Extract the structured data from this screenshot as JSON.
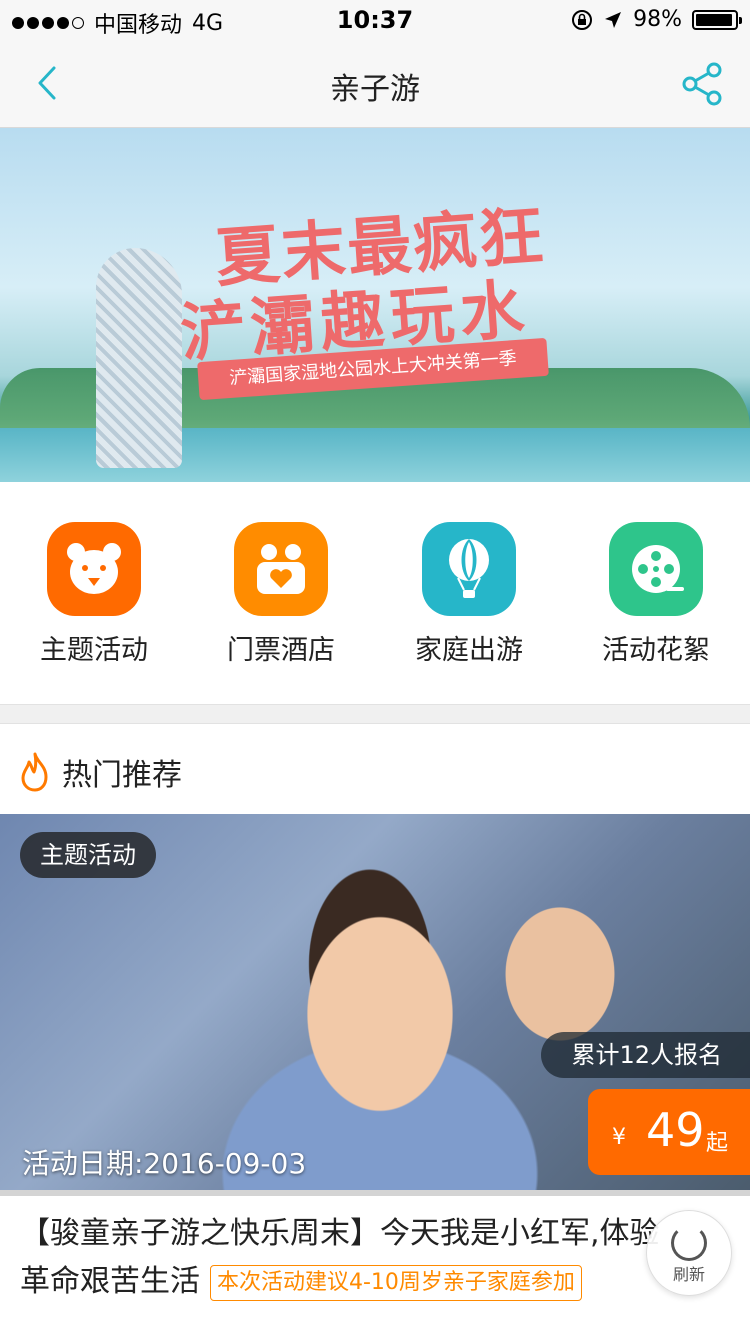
{
  "status_bar": {
    "carrier": "中国移动",
    "network": "4G",
    "time": "10:37",
    "battery": "98%"
  },
  "nav": {
    "title": "亲子游"
  },
  "banner": {
    "line1": "夏末最疯狂",
    "line2": "浐灞趣玩水",
    "ribbon": "浐灞国家湿地公园水上大冲关第一季"
  },
  "categories": [
    {
      "label": "主题活动",
      "icon": "bear-icon",
      "color": "#ff6a00"
    },
    {
      "label": "门票酒店",
      "icon": "family-heart-icon",
      "color": "#ff8c00"
    },
    {
      "label": "家庭出游",
      "icon": "hot-air-balloon-icon",
      "color": "#26b6c9"
    },
    {
      "label": "活动花絮",
      "icon": "film-reel-icon",
      "color": "#2ec58b"
    }
  ],
  "section": {
    "title": "热门推荐"
  },
  "card": {
    "tag": "主题活动",
    "enrolled": "累计12人报名",
    "currency": "¥",
    "price": "49",
    "price_suffix": "起",
    "date": "活动日期:2016-09-03",
    "title": "【骏童亲子游之快乐周末】今天我是小红军,体验革命艰苦生活",
    "advice": "本次活动建议4-10周岁亲子家庭参加"
  },
  "refresh": {
    "label": "刷新"
  },
  "colors": {
    "accent": "#26b6c9",
    "price_bg": "#ff6a00",
    "advice": "#ff8a00"
  }
}
